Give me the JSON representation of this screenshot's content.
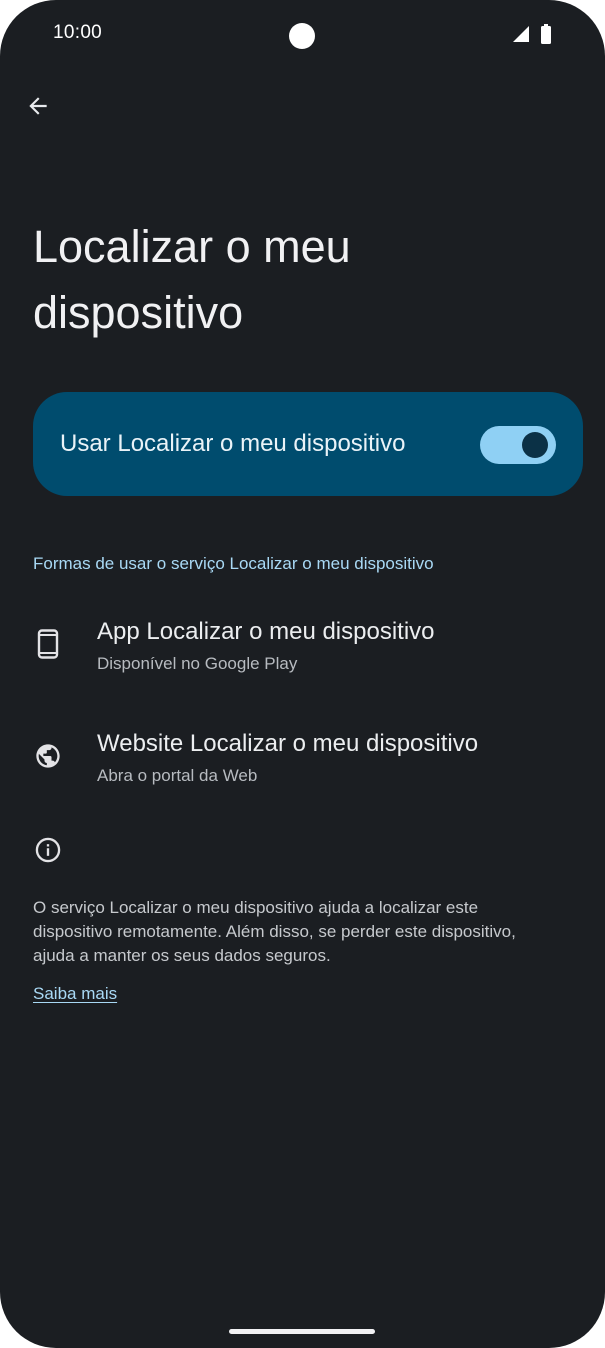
{
  "status_bar": {
    "time": "10:00",
    "icons": [
      "signal-icon",
      "battery-icon"
    ]
  },
  "header": {
    "back_icon": "arrow-back-icon",
    "title": "Localizar o meu dispositivo"
  },
  "main_toggle": {
    "label": "Usar Localizar o meu dispositivo",
    "enabled": true
  },
  "section": {
    "header": "Formas de usar o serviço Localizar o meu dispositivo",
    "items": [
      {
        "icon": "smartphone-icon",
        "title": "App Localizar o meu dispositivo",
        "subtitle": "Disponível no Google Play"
      },
      {
        "icon": "globe-icon",
        "title": "Website Localizar o meu dispositivo",
        "subtitle": "Abra o portal da Web"
      }
    ]
  },
  "info": {
    "icon": "info-icon",
    "text": "O serviço Localizar o meu dispositivo ajuda a localizar este dispositivo remotamente. Além disso, se perder este dispositivo, ajuda a manter os seus dados seguros.",
    "link_label": "Saiba mais"
  },
  "colors": {
    "background": "#1b1e22",
    "card": "#004c6e",
    "accent": "#a9d9f5",
    "switch_track": "#8fd0f4"
  }
}
